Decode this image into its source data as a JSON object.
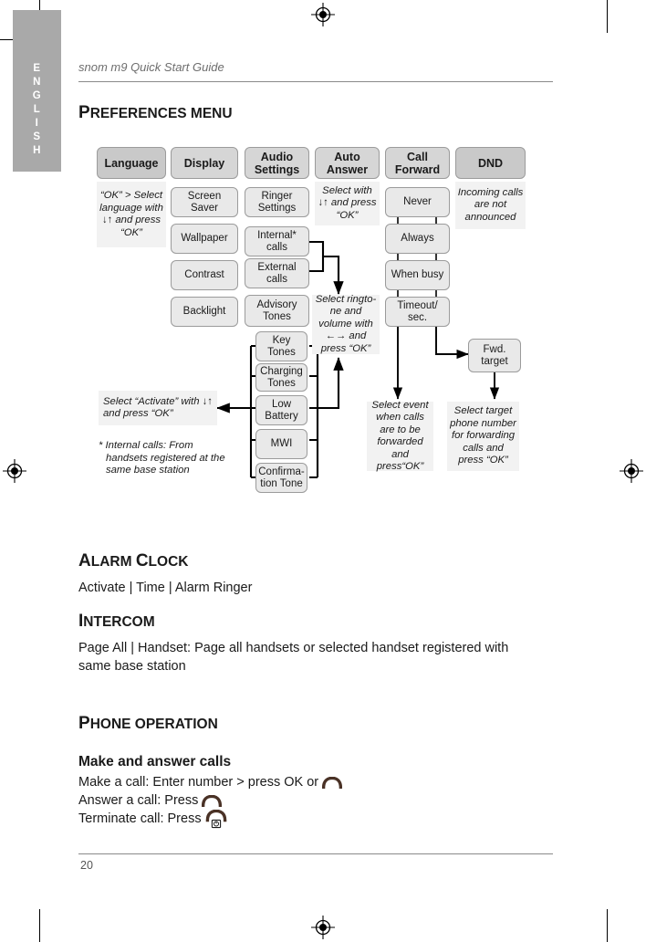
{
  "sidebar": {
    "language_tab": [
      "E",
      "N",
      "G",
      "L",
      "I",
      "S",
      "H"
    ]
  },
  "header": {
    "running_head": "snom m9 Quick Start Guide"
  },
  "footer": {
    "page_number": "20"
  },
  "sections": {
    "preferences": {
      "title_cap": "P",
      "title_rest": "REFERENCES MENU"
    },
    "alarm_clock": {
      "title_cap_1": "A",
      "title_rest_1": "LARM ",
      "title_cap_2": "C",
      "title_rest_2": "LOCK",
      "body": "Activate | Time | Alarm Ringer"
    },
    "intercom": {
      "title_cap": "I",
      "title_rest": "NTERCOM",
      "body": "Page All |  Handset:  Page all handsets or selected handset registered with same base station"
    },
    "phone_operation": {
      "title_cap": "P",
      "title_rest": "HONE OPERATION",
      "subtitle": "Make and answer calls",
      "line_make_label": "Make a call:  Enter number > press OK or",
      "line_answer_label": "Answer a call:  Press",
      "line_terminate_label": "Terminate call:  Press"
    }
  },
  "diagram": {
    "columns": [
      {
        "header": "Language",
        "note": "“OK”  >  Select language with ↓↑ and press “OK”"
      },
      {
        "header": "Display",
        "items": [
          "Screen Saver",
          "Wallpaper",
          "Contrast",
          "Backlight"
        ]
      },
      {
        "header": "Audio Settings",
        "items": [
          "Ringer Settings",
          "Internal* calls",
          "External calls",
          "Advisory Tones"
        ]
      },
      {
        "header": "Auto Answer",
        "note": "Select with ↓↑ and press “OK”"
      },
      {
        "header": "Call Forward",
        "items": [
          "Never",
          "Always",
          "When busy",
          "Timeout/ sec."
        ]
      },
      {
        "header": "DND",
        "note": "Incoming calls are not announced"
      }
    ],
    "advisory_tones": [
      "Key Tones",
      "Charging Tones",
      "Low Battery",
      "MWI",
      "Confirma- tion Tone"
    ],
    "fwd_target": "Fwd. target",
    "notes": {
      "ringtone": "Select ringto-ne and volume with ←→ and press “OK”",
      "activate": "Select “Activate” with ↓↑ and press “OK”",
      "event": "Select event when calls are to be forwarded and press“OK”",
      "target": "Select target phone number for forwarding calls and press “OK”"
    },
    "footnote_marker": "*",
    "footnote_line1": "Internal calls:  From",
    "footnote_line2": "handsets registered at the",
    "footnote_line3": "same base station"
  },
  "colors": {
    "tab_gray": "#a9a9a9",
    "node_fill": "#e9e9e9",
    "header_fill": "#d6d6d6",
    "note_fill": "#f2f2f2",
    "handset": "#4a3226"
  }
}
